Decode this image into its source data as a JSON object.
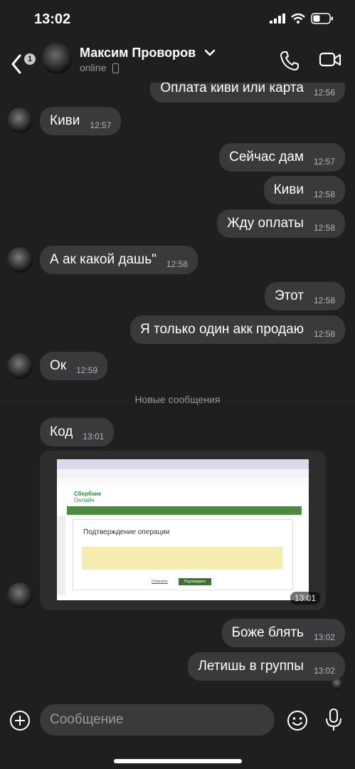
{
  "status": {
    "time": "13:02"
  },
  "header": {
    "back_badge": "1",
    "contact_name": "Максим Проворов",
    "presence": "online"
  },
  "messages": [
    {
      "dir": "out",
      "text": "Оплата киви или карта",
      "time": "12:56"
    },
    {
      "dir": "in",
      "text": "Киви",
      "time": "12:57"
    },
    {
      "dir": "out",
      "text": "Сейчас дам",
      "time": "12:57"
    },
    {
      "dir": "out",
      "text": "Киви",
      "time": "12:58"
    },
    {
      "dir": "out",
      "text": "Жду оплаты",
      "time": "12:58"
    },
    {
      "dir": "in",
      "text": "А ак какой дашь\"",
      "time": "12:58"
    },
    {
      "dir": "out",
      "text": "Этот",
      "time": "12:58"
    },
    {
      "dir": "out",
      "text": "Я только один акк продаю",
      "time": "12:58"
    },
    {
      "dir": "in",
      "text": "Ок",
      "time": "12:59"
    },
    {
      "dir": "in",
      "text": "Код",
      "time": "13:01"
    },
    {
      "dir": "out",
      "text": "Боже блять",
      "time": "13:02"
    },
    {
      "dir": "out",
      "text": "Летишь в группы",
      "time": "13:02"
    }
  ],
  "divider_label": "Новые сообщения",
  "media": {
    "time": "13:01",
    "screenshot": {
      "logo_top": "Сбербанк",
      "logo_bottom": "Онлайн",
      "dialog_title": "Подтверждение операции",
      "confirm_button": "Подтвердить",
      "cancel_link": "Отменить"
    }
  },
  "input": {
    "placeholder": "Сообщение"
  }
}
